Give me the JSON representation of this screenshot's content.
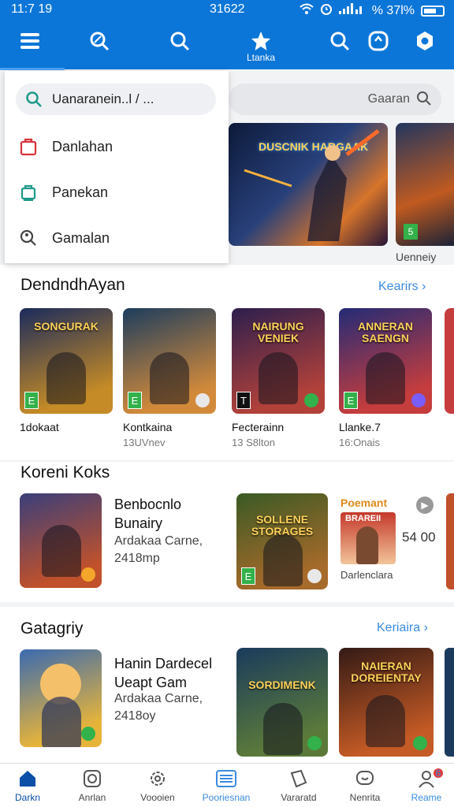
{
  "status_bar": {
    "time_left": "11:7 19",
    "time_center": "31622",
    "battery": "% 37l%"
  },
  "app_bar": {
    "star_label": "Ltanka"
  },
  "dropdown": {
    "search_value": "Uanaranein..l / ...",
    "items": [
      {
        "label": "Danlahan",
        "icon": "bag-icon"
      },
      {
        "label": "Panekan",
        "icon": "shop-icon"
      },
      {
        "label": "Gamalan",
        "icon": "user-search-icon"
      }
    ]
  },
  "search": {
    "placeholder": "Gaaran"
  },
  "hero": {
    "title": "DUSCNIK HARGAAK",
    "caption": "Uenneiy",
    "rating_badge": "5"
  },
  "section1": {
    "title": "DendndhAyan",
    "link": "Kearirs",
    "tiles": [
      {
        "title": "SONGURAK",
        "name": "1dokaat",
        "sub": "",
        "rating": "E",
        "colors": [
          "#1b2b5c",
          "#c58b26"
        ]
      },
      {
        "title": "",
        "name": "Kontkaina",
        "sub": "13UVnev",
        "rating": "E",
        "colors": [
          "#1d3d5e",
          "#d28a3a"
        ]
      },
      {
        "title": "NAIRUNG VENIEK",
        "name": "Fecterainn",
        "sub": "13 S8lton",
        "rating": "T",
        "colors": [
          "#2c1f4d",
          "#b2413a"
        ]
      },
      {
        "title": "ANNERAN SAENGN",
        "name": "Llanke.7",
        "sub": "16:Onais",
        "rating": "E",
        "colors": [
          "#232b76",
          "#c63d3d"
        ]
      }
    ]
  },
  "section2": {
    "title": "Koreni Koks",
    "item": {
      "title_line1": "Benbocnlo",
      "title_line2": "Bunairy",
      "sub_line1": "Ardakaa Carne,",
      "sub_line2": "2418mp"
    },
    "tiles": [
      {
        "title": "SOLLENE STORAGES",
        "colors": [
          "#3a5a25",
          "#a66a2a"
        ],
        "rating": "E"
      }
    ],
    "promo": {
      "label": "Poemant",
      "banner": "BRAREII",
      "caption": "Darlenclara",
      "price": "54 00"
    }
  },
  "section3": {
    "title": "Gatagriy",
    "link": "Keriaira",
    "item": {
      "title_line1": "Hanin Dardecel",
      "title_line2": "Ueapt Gam",
      "sub_line1": "Ardakaa Carne,",
      "sub_line2": "2418oy"
    },
    "tiles": [
      {
        "title": "SORDIMENK",
        "colors": [
          "#1a3b5c",
          "#5b7a3a"
        ]
      },
      {
        "title": "NAIERAN DOREIENTAY",
        "colors": [
          "#331a15",
          "#c45a25"
        ]
      }
    ]
  },
  "bottom_nav": [
    {
      "label": "Darkn",
      "icon": "home-icon",
      "active": true
    },
    {
      "label": "Anrlan",
      "icon": "camera-icon"
    },
    {
      "label": "Voooien",
      "icon": "gear-icon"
    },
    {
      "label": "Pooriesnan",
      "icon": "list-icon"
    },
    {
      "label": "Vararatd",
      "icon": "tag-icon"
    },
    {
      "label": "Nenrita",
      "icon": "chat-icon"
    },
    {
      "label": "Reame",
      "icon": "profile-icon",
      "badge": "6"
    }
  ],
  "colors": {
    "primary": "#0b76d8",
    "accent_link": "#3b8be0",
    "rating_green": "#33b14a"
  }
}
